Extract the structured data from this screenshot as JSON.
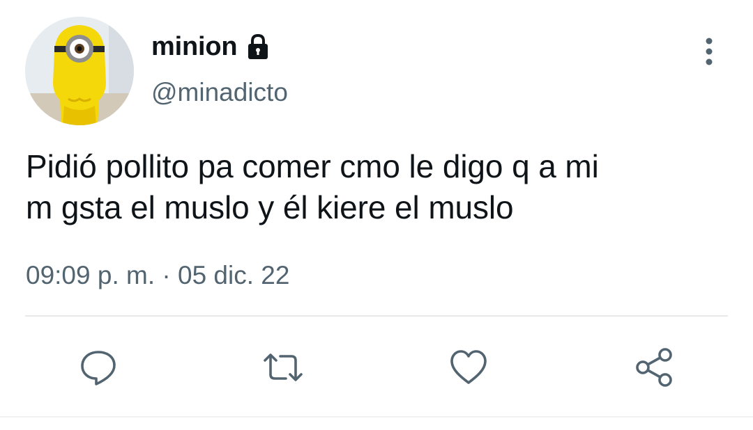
{
  "user": {
    "display_name": "minion",
    "handle": "@minadicto",
    "avatar_icon": "minion-avatar",
    "protected_icon": "lock-icon"
  },
  "tweet": {
    "text_lines": [
      "Pidió pollito pa comer cmo le digo q a mi",
      "m gsta el muslo y él kiere el muslo"
    ],
    "timestamp": "09:09 p. m. · 05 dic. 22"
  },
  "actions": [
    {
      "name": "reply",
      "icon": "reply-icon"
    },
    {
      "name": "retweet",
      "icon": "retweet-icon"
    },
    {
      "name": "like",
      "icon": "heart-icon"
    },
    {
      "name": "share",
      "icon": "share-icon"
    }
  ],
  "colors": {
    "text_primary": "#0f1419",
    "text_secondary": "#536471",
    "divider": "#e7e9eb",
    "avatar_yellow": "#f5d80a"
  }
}
